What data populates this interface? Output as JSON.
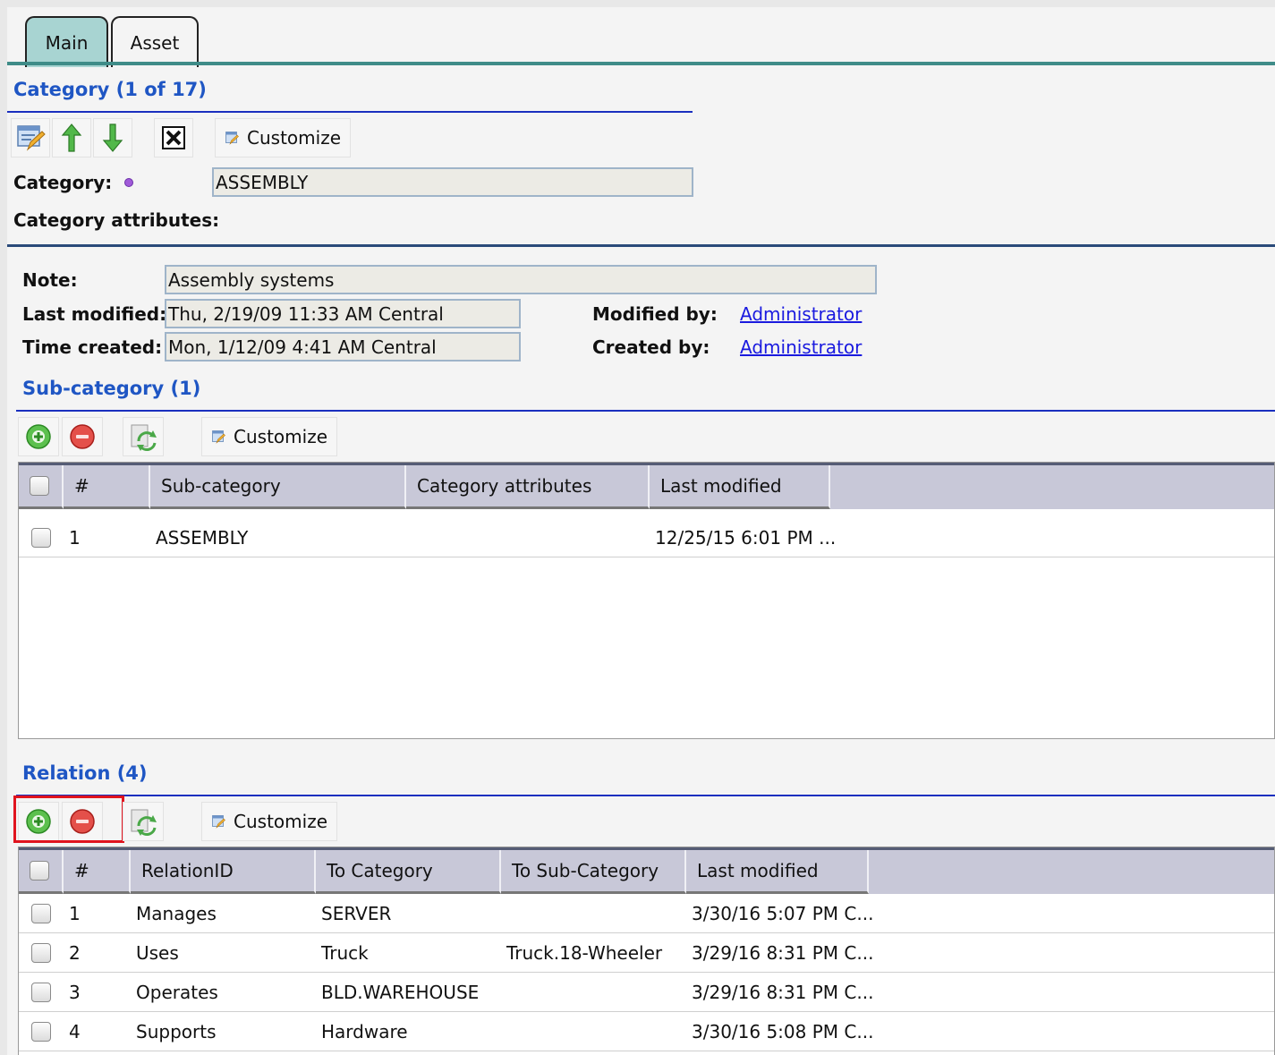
{
  "tabs": [
    {
      "label": "Main",
      "active": true
    },
    {
      "label": "Asset",
      "active": false
    }
  ],
  "category_section": {
    "title": "Category (1 of 17)",
    "toolbar": {
      "customize_label": "Customize"
    },
    "category_label": "Category:",
    "category_value": "ASSEMBLY",
    "attributes_label": "Category attributes:"
  },
  "details": {
    "note_label": "Note:",
    "note_value": "Assembly systems",
    "last_modified_label": "Last modified:",
    "last_modified_value": "Thu, 2/19/09 11:33 AM Central",
    "time_created_label": "Time created:",
    "time_created_value": "Mon, 1/12/09 4:41 AM Central",
    "modified_by_label": "Modified by:",
    "modified_by_value": "Administrator",
    "created_by_label": "Created by:",
    "created_by_value": "Administrator"
  },
  "subcategory": {
    "title": "Sub-category (1)",
    "customize_label": "Customize",
    "columns": [
      "#",
      "Sub-category",
      "Category attributes",
      "Last modified"
    ],
    "rows": [
      {
        "num": "1",
        "name": "ASSEMBLY",
        "attributes": "",
        "last_modified": "12/25/15 6:01 PM ..."
      }
    ]
  },
  "relation": {
    "title": "Relation (4)",
    "customize_label": "Customize",
    "columns": [
      "#",
      "RelationID",
      "To Category",
      "To Sub-Category",
      "Last modified"
    ],
    "rows": [
      {
        "num": "1",
        "relation_id": "Manages",
        "to_category": "SERVER",
        "to_sub_category": "",
        "last_modified": "3/30/16 5:07 PM C..."
      },
      {
        "num": "2",
        "relation_id": "Uses",
        "to_category": "Truck",
        "to_sub_category": "Truck.18-Wheeler",
        "last_modified": "3/29/16 8:31 PM C..."
      },
      {
        "num": "3",
        "relation_id": "Operates",
        "to_category": "BLD.WAREHOUSE",
        "to_sub_category": "",
        "last_modified": "3/29/16 8:31 PM C..."
      },
      {
        "num": "4",
        "relation_id": "Supports",
        "to_category": "Hardware",
        "to_sub_category": "",
        "last_modified": "3/30/16 5:08 PM C..."
      }
    ]
  },
  "colors": {
    "tab_active": "#a8d4d2",
    "section_title": "#1f56c4",
    "link": "#1a1adf",
    "highlight": "#e0141e"
  }
}
